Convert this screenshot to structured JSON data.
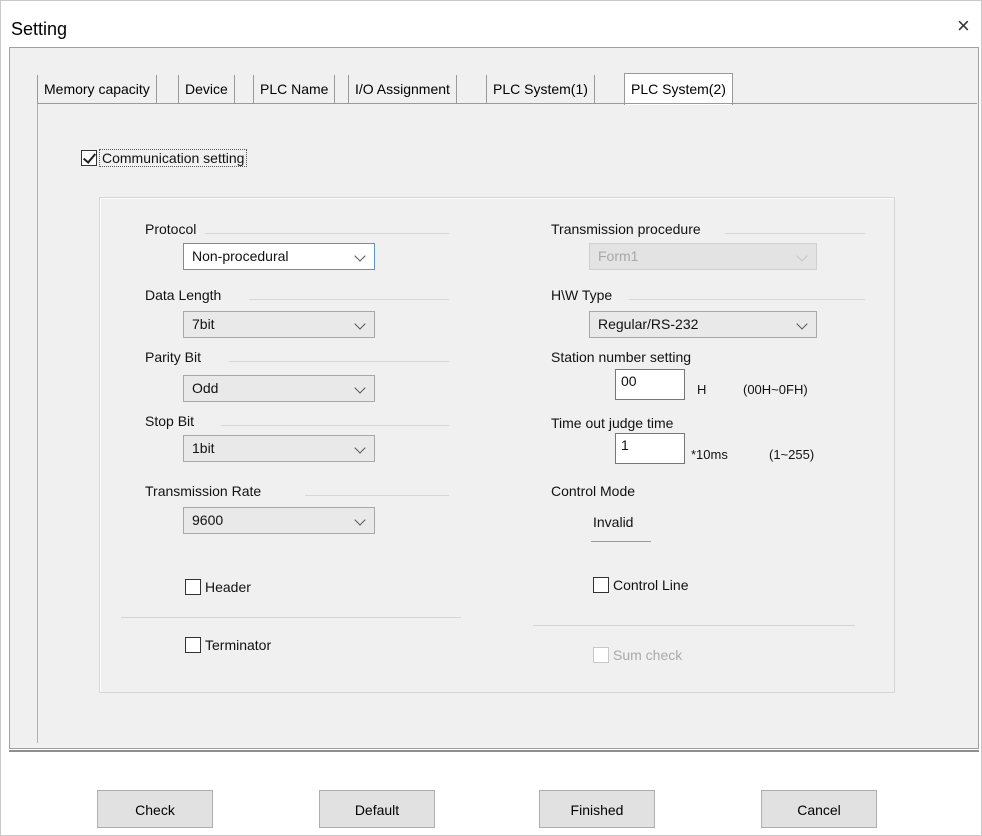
{
  "window": {
    "title": "Setting",
    "close_glyph": "×"
  },
  "tabs": [
    {
      "label": "Memory capacity",
      "active": false
    },
    {
      "label": "Device",
      "active": false
    },
    {
      "label": "PLC Name",
      "active": false
    },
    {
      "label": "I/O Assignment",
      "active": false
    },
    {
      "label": "PLC System(1)",
      "active": false
    },
    {
      "label": "PLC System(2)",
      "active": true
    }
  ],
  "communication_setting": {
    "label": "Communication setting",
    "checked": true
  },
  "left": {
    "protocol": {
      "label": "Protocol",
      "value": "Non-procedural"
    },
    "data_length": {
      "label": "Data Length",
      "value": "7bit"
    },
    "parity_bit": {
      "label": "Parity Bit",
      "value": "Odd"
    },
    "stop_bit": {
      "label": "Stop Bit",
      "value": "1bit"
    },
    "transmission_rate": {
      "label": "Transmission Rate",
      "value": "9600"
    },
    "header": {
      "label": "Header",
      "checked": false
    },
    "terminator": {
      "label": "Terminator",
      "checked": false
    }
  },
  "right": {
    "transmission_procedure": {
      "label": "Transmission procedure",
      "value": "Form1",
      "disabled": true
    },
    "hw_type": {
      "label": "H\\W Type",
      "value": "Regular/RS-232"
    },
    "station_number": {
      "label": "Station number setting",
      "value": "00",
      "unit": "H",
      "range": "(00H~0FH)"
    },
    "time_out": {
      "label": "Time out judge time",
      "value": "1",
      "unit": "*10ms",
      "range": "(1~255)"
    },
    "control_mode": {
      "label": "Control Mode",
      "value": "Invalid"
    },
    "control_line": {
      "label": "Control Line",
      "checked": false
    },
    "sum_check": {
      "label": "Sum check",
      "checked": false,
      "disabled": true
    }
  },
  "buttons": {
    "check": "Check",
    "default": "Default",
    "finished": "Finished",
    "cancel": "Cancel"
  }
}
